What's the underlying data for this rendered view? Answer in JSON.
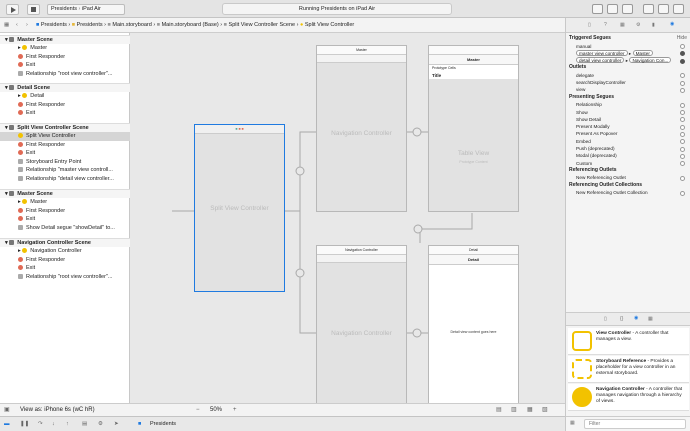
{
  "toolbar": {
    "scheme": "Presidents",
    "device": "iPad Air",
    "status": "Running Presidents on iPad Air"
  },
  "jumpbar": {
    "crumbs": [
      "Presidents",
      "Presidents",
      "Main.storyboard",
      "Main.storyboard (Base)",
      "Split View Controller Scene",
      "Split View Controller"
    ]
  },
  "navigator": {
    "scenes": [
      {
        "title": "Master Scene",
        "items": [
          {
            "label": "Master",
            "kind": "yl"
          },
          {
            "label": "First Responder",
            "kind": "rd"
          },
          {
            "label": "Exit",
            "kind": "rd"
          },
          {
            "label": "Relationship \"root view controller\"...",
            "kind": "gy"
          }
        ]
      },
      {
        "title": "Detail Scene",
        "items": [
          {
            "label": "Detail",
            "kind": "yl"
          },
          {
            "label": "First Responder",
            "kind": "rd"
          },
          {
            "label": "Exit",
            "kind": "rd"
          }
        ]
      },
      {
        "title": "Split View Controller Scene",
        "items": [
          {
            "label": "Split View Controller",
            "kind": "yl",
            "selected": true
          },
          {
            "label": "First Responder",
            "kind": "rd"
          },
          {
            "label": "Exit",
            "kind": "rd"
          },
          {
            "label": "Storyboard Entry Point",
            "kind": "gy"
          },
          {
            "label": "Relationship \"master view controll...",
            "kind": "gy"
          },
          {
            "label": "Relationship \"detail view controller...",
            "kind": "gy"
          }
        ]
      },
      {
        "title": "Master Scene",
        "items": [
          {
            "label": "Master",
            "kind": "yl"
          },
          {
            "label": "First Responder",
            "kind": "rd"
          },
          {
            "label": "Exit",
            "kind": "rd"
          },
          {
            "label": "Show Detail segue \"showDetail\" to...",
            "kind": "gy"
          }
        ]
      },
      {
        "title": "Navigation Controller Scene",
        "items": [
          {
            "label": "Navigation Controller",
            "kind": "yl"
          },
          {
            "label": "First Responder",
            "kind": "rd"
          },
          {
            "label": "Exit",
            "kind": "rd"
          },
          {
            "label": "Relationship \"root view controller\"...",
            "kind": "gy"
          }
        ]
      }
    ],
    "filter_placeholder": "Filter"
  },
  "canvas": {
    "split_vc_title": "Split View Controller",
    "nav_top_header": "Master",
    "nav_top_title": "Navigation Controller",
    "table_header": "Master",
    "prototype_cells": "Prototype Cells",
    "title_cell": "Title",
    "table_view": "Table View",
    "prototype_content": "Prototype Content",
    "nav_bottom_header": "Navigation Controller",
    "nav_bottom_title": "Navigation Controller",
    "detail_header": "Detail",
    "detail_navbar": "Detail",
    "detail_body": "Detail view content goes here"
  },
  "bottombar": {
    "view_as": "View as: iPhone 6s (wC hR)",
    "zoom": "50%"
  },
  "inspector": {
    "hide": "Hide",
    "triggered_segues": "Triggered Segues",
    "manual": "manual",
    "master_vc": "master view controller",
    "master_target": "Master",
    "detail_vc": "detail view controller",
    "detail_target": "Navigation Con...",
    "outlets": "Outlets",
    "outlet_items": [
      "delegate",
      "searchDisplayController",
      "view"
    ],
    "presenting_segues": "Presenting Segues",
    "presenting_items": [
      "Relationship",
      "Show",
      "Show Detail",
      "Present Modally",
      "Present As Popover",
      "Embed",
      "Push (deprecated)",
      "Modal (deprecated)",
      "Custom"
    ],
    "referencing_outlets": "Referencing Outlets",
    "new_ref_outlet": "New Referencing Outlet",
    "referencing_outlet_collections": "Referencing Outlet Collections",
    "new_ref_outlet_collection": "New Referencing Outlet Collection"
  },
  "library": {
    "items": [
      {
        "name": "View Controller",
        "desc": " - A controller that manages a view."
      },
      {
        "name": "Storyboard Reference",
        "desc": " - Provides a placeholder for a view controller in an external storyboard."
      },
      {
        "name": "Navigation Controller",
        "desc": " - A controller that manages navigation through a hierarchy of views."
      }
    ],
    "filter_placeholder": "Filter"
  },
  "debugbar": {
    "target": "Presidents"
  },
  "colors": {
    "accent": "#1f7ae0",
    "scene_icon": "#f2c200",
    "responder": "#e06a55"
  }
}
